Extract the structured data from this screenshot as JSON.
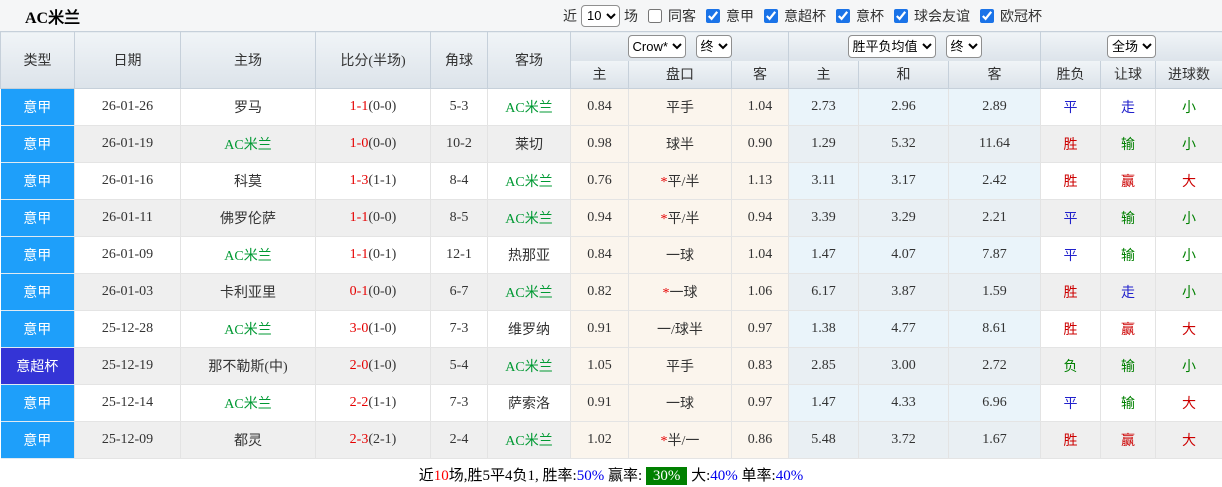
{
  "page": {
    "title": "AC米兰"
  },
  "toolbar": {
    "recent_label": "近",
    "matches_value": "10",
    "matches_label": "场",
    "same_venue": {
      "label": "同客",
      "checked": false
    },
    "league_filters": [
      {
        "label": "意甲",
        "checked": true
      },
      {
        "label": "意超杯",
        "checked": true
      },
      {
        "label": "意杯",
        "checked": true
      },
      {
        "label": "球会友谊",
        "checked": true
      },
      {
        "label": "欧冠杯",
        "checked": true
      }
    ]
  },
  "table": {
    "main_headers": [
      "类型",
      "日期",
      "主场",
      "比分(半场)",
      "角球",
      "客场"
    ],
    "selects": {
      "odds_provider": "Crow*",
      "odds_stage": "终",
      "avg_type": "胜平负均值",
      "avg_stage": "终",
      "scope": "全场"
    },
    "sub_headers": [
      "主",
      "盘口",
      "客",
      "主",
      "和",
      "客",
      "胜负",
      "让球",
      "进球数"
    ],
    "rows": [
      {
        "league": "意甲",
        "league_style": "serie-a",
        "date": "26-01-26",
        "home": "罗马",
        "home_target": false,
        "ft": "1-1",
        "ht": "(0-0)",
        "corners": "5-3",
        "away": "AC米兰",
        "away_target": true,
        "crow_home": "0.84",
        "handicap_star": "",
        "handicap": "平手",
        "crow_away": "1.04",
        "avg_home": "2.73",
        "avg_draw": "2.96",
        "avg_away": "2.89",
        "result_text": "平",
        "result_color": "blue",
        "handicap_result_text": "走",
        "handicap_result_color": "blue",
        "goals_text": "小",
        "goals_color": "green"
      },
      {
        "league": "意甲",
        "league_style": "serie-a",
        "date": "26-01-19",
        "home": "AC米兰",
        "home_target": true,
        "ft": "1-0",
        "ht": "(0-0)",
        "corners": "10-2",
        "away": "莱切",
        "away_target": false,
        "crow_home": "0.98",
        "handicap_star": "",
        "handicap": "球半",
        "crow_away": "0.90",
        "avg_home": "1.29",
        "avg_draw": "5.32",
        "avg_away": "11.64",
        "result_text": "胜",
        "result_color": "red",
        "handicap_result_text": "输",
        "handicap_result_color": "green",
        "goals_text": "小",
        "goals_color": "green"
      },
      {
        "league": "意甲",
        "league_style": "serie-a",
        "date": "26-01-16",
        "home": "科莫",
        "home_target": false,
        "ft": "1-3",
        "ht": "(1-1)",
        "corners": "8-4",
        "away": "AC米兰",
        "away_target": true,
        "crow_home": "0.76",
        "handicap_star": "*",
        "handicap": "平/半",
        "crow_away": "1.13",
        "avg_home": "3.11",
        "avg_draw": "3.17",
        "avg_away": "2.42",
        "result_text": "胜",
        "result_color": "red",
        "handicap_result_text": "赢",
        "handicap_result_color": "red",
        "goals_text": "大",
        "goals_color": "red"
      },
      {
        "league": "意甲",
        "league_style": "serie-a",
        "date": "26-01-11",
        "home": "佛罗伦萨",
        "home_target": false,
        "ft": "1-1",
        "ht": "(0-0)",
        "corners": "8-5",
        "away": "AC米兰",
        "away_target": true,
        "crow_home": "0.94",
        "handicap_star": "*",
        "handicap": "平/半",
        "crow_away": "0.94",
        "avg_home": "3.39",
        "avg_draw": "3.29",
        "avg_away": "2.21",
        "result_text": "平",
        "result_color": "blue",
        "handicap_result_text": "输",
        "handicap_result_color": "green",
        "goals_text": "小",
        "goals_color": "green"
      },
      {
        "league": "意甲",
        "league_style": "serie-a",
        "date": "26-01-09",
        "home": "AC米兰",
        "home_target": true,
        "ft": "1-1",
        "ht": "(0-1)",
        "corners": "12-1",
        "away": "热那亚",
        "away_target": false,
        "crow_home": "0.84",
        "handicap_star": "",
        "handicap": "一球",
        "crow_away": "1.04",
        "avg_home": "1.47",
        "avg_draw": "4.07",
        "avg_away": "7.87",
        "result_text": "平",
        "result_color": "blue",
        "handicap_result_text": "输",
        "handicap_result_color": "green",
        "goals_text": "小",
        "goals_color": "green"
      },
      {
        "league": "意甲",
        "league_style": "serie-a",
        "date": "26-01-03",
        "home": "卡利亚里",
        "home_target": false,
        "ft": "0-1",
        "ht": "(0-0)",
        "corners": "6-7",
        "away": "AC米兰",
        "away_target": true,
        "crow_home": "0.82",
        "handicap_star": "*",
        "handicap": "一球",
        "crow_away": "1.06",
        "avg_home": "6.17",
        "avg_draw": "3.87",
        "avg_away": "1.59",
        "result_text": "胜",
        "result_color": "red",
        "handicap_result_text": "走",
        "handicap_result_color": "blue",
        "goals_text": "小",
        "goals_color": "green"
      },
      {
        "league": "意甲",
        "league_style": "serie-a",
        "date": "25-12-28",
        "home": "AC米兰",
        "home_target": true,
        "ft": "3-0",
        "ht": "(1-0)",
        "corners": "7-3",
        "away": "维罗纳",
        "away_target": false,
        "crow_home": "0.91",
        "handicap_star": "",
        "handicap": "一/球半",
        "crow_away": "0.97",
        "avg_home": "1.38",
        "avg_draw": "4.77",
        "avg_away": "8.61",
        "result_text": "胜",
        "result_color": "red",
        "handicap_result_text": "赢",
        "handicap_result_color": "red",
        "goals_text": "大",
        "goals_color": "red"
      },
      {
        "league": "意超杯",
        "league_style": "super-cup",
        "date": "25-12-19",
        "home": "那不勒斯(中)",
        "home_target": false,
        "ft": "2-0",
        "ht": "(1-0)",
        "corners": "5-4",
        "away": "AC米兰",
        "away_target": true,
        "crow_home": "1.05",
        "handicap_star": "",
        "handicap": "平手",
        "crow_away": "0.83",
        "avg_home": "2.85",
        "avg_draw": "3.00",
        "avg_away": "2.72",
        "result_text": "负",
        "result_color": "green",
        "handicap_result_text": "输",
        "handicap_result_color": "green",
        "goals_text": "小",
        "goals_color": "green"
      },
      {
        "league": "意甲",
        "league_style": "serie-a",
        "date": "25-12-14",
        "home": "AC米兰",
        "home_target": true,
        "ft": "2-2",
        "ht": "(1-1)",
        "corners": "7-3",
        "away": "萨索洛",
        "away_target": false,
        "crow_home": "0.91",
        "handicap_star": "",
        "handicap": "一球",
        "crow_away": "0.97",
        "avg_home": "1.47",
        "avg_draw": "4.33",
        "avg_away": "6.96",
        "result_text": "平",
        "result_color": "blue",
        "handicap_result_text": "输",
        "handicap_result_color": "green",
        "goals_text": "大",
        "goals_color": "red"
      },
      {
        "league": "意甲",
        "league_style": "serie-a",
        "date": "25-12-09",
        "home": "都灵",
        "home_target": false,
        "ft": "2-3",
        "ht": "(2-1)",
        "corners": "2-4",
        "away": "AC米兰",
        "away_target": true,
        "crow_home": "1.02",
        "handicap_star": "*",
        "handicap": "半/一",
        "crow_away": "0.86",
        "avg_home": "5.48",
        "avg_draw": "3.72",
        "avg_away": "1.67",
        "result_text": "胜",
        "result_color": "red",
        "handicap_result_text": "赢",
        "handicap_result_color": "red",
        "goals_text": "大",
        "goals_color": "red"
      }
    ]
  },
  "summary": {
    "prefix": "近",
    "count": "10",
    "mid": "场,胜5平4负1, 胜率:",
    "win_rate": "50%",
    "win_label": " 赢率: ",
    "big_win_rate": "30%",
    "big_label": " 大:",
    "big_rate": "40%",
    "single_label": " 单率:",
    "single_rate": "40%"
  },
  "colors": {
    "serie_a_badge": "#1e9ffa",
    "super_cup_badge": "#3434d6",
    "score_red": "#e60000",
    "target_team_green": "#009933",
    "result_red": "#cc0000",
    "result_blue": "#2222cc",
    "result_green": "#008000",
    "summary_badge_green": "#008000"
  }
}
